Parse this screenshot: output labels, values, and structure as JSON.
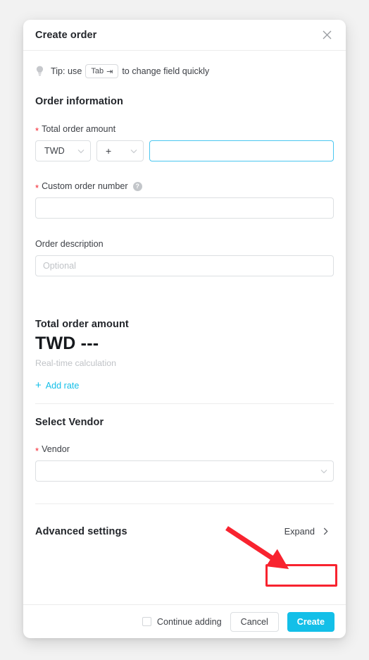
{
  "modal": {
    "title": "Create order",
    "close_icon": "close-icon"
  },
  "tip": {
    "icon": "lightbulb-icon",
    "text_before": "Tip: use",
    "key_label": "Tab",
    "key_glyph": "⇥",
    "text_after": "to change field quickly"
  },
  "order_information": {
    "heading": "Order information",
    "total_order_amount": {
      "label": "Total order amount",
      "required_marker": "*",
      "currency_value": "TWD",
      "operator_value": "+",
      "amount_value": "",
      "amount_placeholder": ""
    },
    "custom_order_number": {
      "label": "Custom order number",
      "required_marker": "*",
      "help_icon": "question-mark-icon",
      "help_glyph": "?",
      "value": "",
      "placeholder": ""
    },
    "order_description": {
      "label": "Order description",
      "value": "",
      "placeholder": "Optional"
    }
  },
  "total_summary": {
    "heading": "Total order amount",
    "value": "TWD ---",
    "note": "Real-time calculation",
    "add_rate_label": "Add rate",
    "add_rate_plus": "+"
  },
  "select_vendor": {
    "heading": "Select Vendor",
    "vendor_label": "Vendor",
    "required_marker": "*",
    "vendor_value": ""
  },
  "advanced_settings": {
    "heading": "Advanced settings",
    "expand_label": "Expand",
    "expand_chevron": "›"
  },
  "footer": {
    "continue_adding_label": "Continue adding",
    "continue_adding_checked": false,
    "cancel_label": "Cancel",
    "create_label": "Create"
  },
  "colors": {
    "accent": "#13bfe8",
    "focus_border": "#4ac7f0",
    "required_star": "#f5222d",
    "annotation_red": "#f8232f",
    "text_primary": "#23262b",
    "text_muted": "#c0c3c7",
    "divider": "#ededed"
  },
  "annotations": {
    "arrow": "red-arrow-pointing-to-expand",
    "highlight": "red-box-around-expand-button"
  }
}
